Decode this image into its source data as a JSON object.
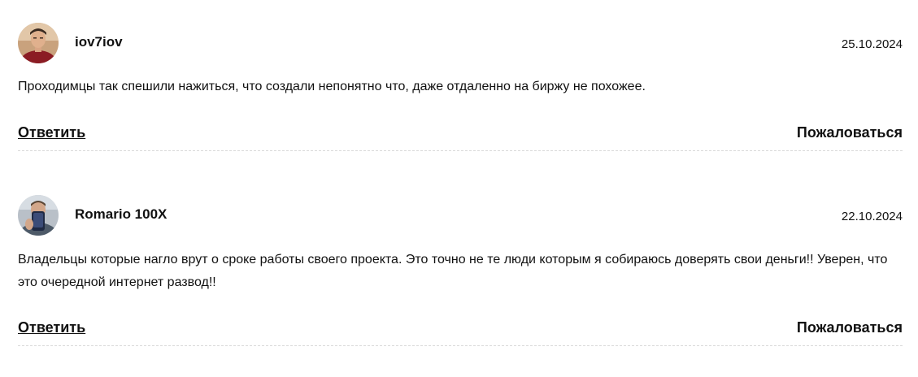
{
  "comments": [
    {
      "avatar_icon": "user-avatar-icon",
      "username": "iov7iov",
      "date": "25.10.2024",
      "text": "Проходимцы так спешили нажиться, что создали непонятно что, даже отдаленно на биржу не похожее.",
      "reply_label": "Ответить",
      "report_label": "Пожаловаться"
    },
    {
      "avatar_icon": "user-avatar-icon",
      "username": "Romario 100X",
      "date": "22.10.2024",
      "text": "Владельцы которые нагло врут о сроке работы своего проекта. Это точно не те люди которым я собираюсь доверять свои деньги!! Уверен, что это очередной интернет развод!!",
      "reply_label": "Ответить",
      "report_label": "Пожаловаться"
    }
  ],
  "colors": {
    "text": "#111111",
    "divider": "#d9d9d9",
    "background": "#ffffff"
  }
}
